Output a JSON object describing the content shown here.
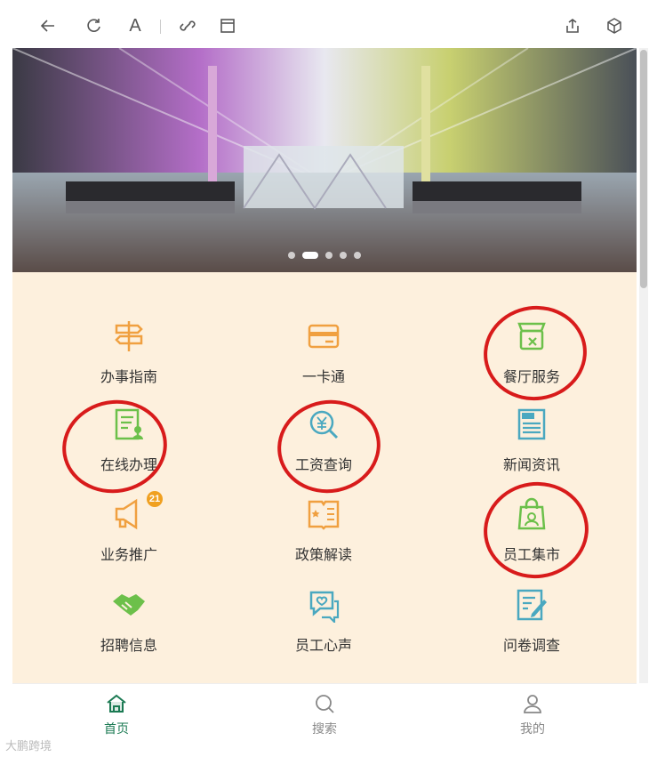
{
  "toolbar": {
    "icons": [
      "back-arrow-icon",
      "refresh-icon",
      "font-icon",
      "link-icon",
      "window-icon",
      "share-icon",
      "cube-icon"
    ],
    "font_glyph": "A"
  },
  "banner": {
    "dots": 5,
    "active_index": 1
  },
  "grid": {
    "items": [
      {
        "label": "办事指南",
        "icon": "signpost-icon",
        "color": "#f0a040"
      },
      {
        "label": "一卡通",
        "icon": "card-icon",
        "color": "#f0a040"
      },
      {
        "label": "餐厅服务",
        "icon": "restaurant-icon",
        "color": "#6cc04a"
      },
      {
        "label": "在线办理",
        "icon": "document-user-icon",
        "color": "#6cc04a"
      },
      {
        "label": "工资查询",
        "icon": "yen-search-icon",
        "color": "#4aa8c0"
      },
      {
        "label": "新闻资讯",
        "icon": "news-icon",
        "color": "#4aa8c0"
      },
      {
        "label": "业务推广",
        "icon": "megaphone-icon",
        "color": "#f0a040",
        "badge": "21"
      },
      {
        "label": "政策解读",
        "icon": "book-icon",
        "color": "#f0a040"
      },
      {
        "label": "员工集市",
        "icon": "shopping-bag-icon",
        "color": "#6cc04a"
      },
      {
        "label": "招聘信息",
        "icon": "handshake-icon",
        "color": "#6cc04a"
      },
      {
        "label": "员工心声",
        "icon": "heart-chat-icon",
        "color": "#4aa8c0"
      },
      {
        "label": "问卷调查",
        "icon": "survey-icon",
        "color": "#4aa8c0"
      }
    ]
  },
  "tabs": [
    {
      "label": "首页",
      "icon": "home-icon",
      "active": true
    },
    {
      "label": "搜索",
      "icon": "search-icon",
      "active": false
    },
    {
      "label": "我的",
      "icon": "user-icon",
      "active": false
    }
  ],
  "watermark": "大鹏跨境",
  "colors": {
    "annotation": "#d81b1b",
    "background": "#fdf0dd",
    "active_tab": "#1b7a53"
  }
}
